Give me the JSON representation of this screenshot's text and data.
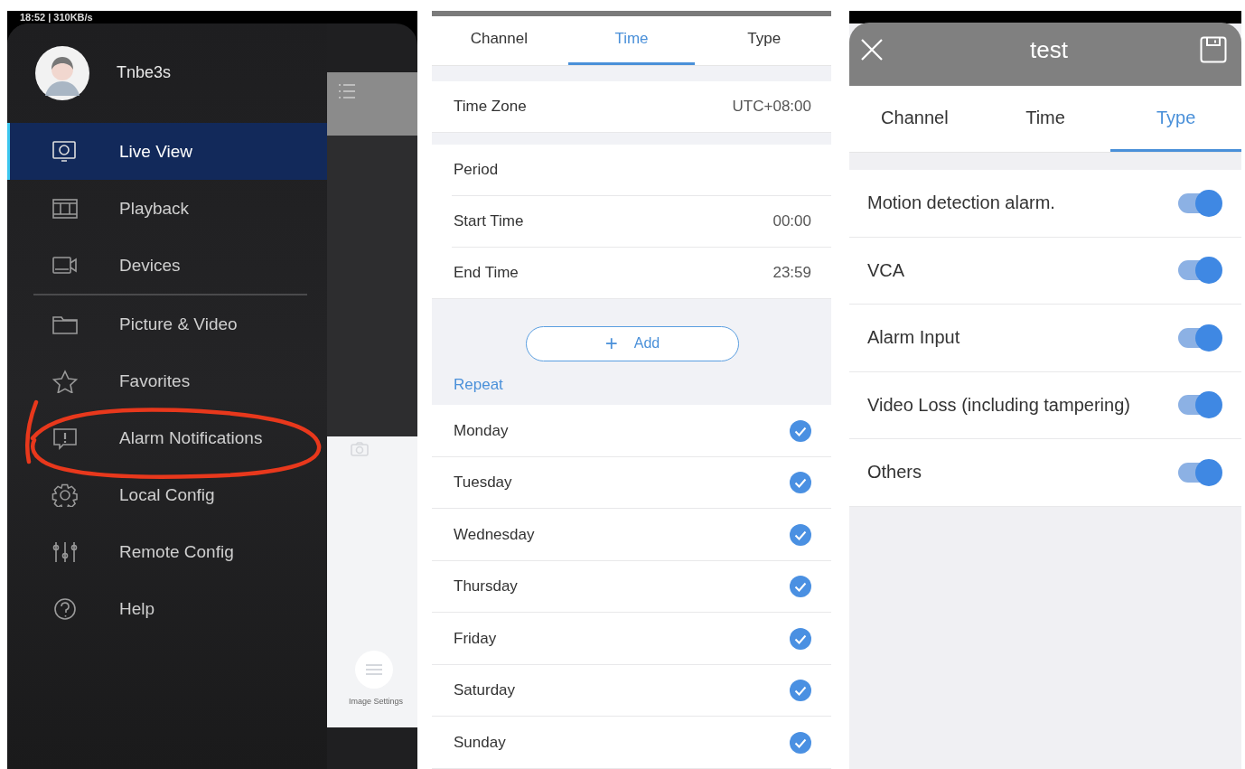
{
  "drawer": {
    "status_bar": {
      "text": "18:52 | 310KB/s"
    },
    "user": {
      "name": "Tnbe3s"
    },
    "groups": [
      {
        "items": [
          {
            "label": "Live View",
            "selected": true,
            "circled": false
          },
          {
            "label": "Playback",
            "selected": false,
            "circled": false
          },
          {
            "label": "Devices",
            "selected": false,
            "circled": false
          }
        ]
      },
      {
        "items": [
          {
            "label": "Picture & Video",
            "selected": false,
            "circled": false
          },
          {
            "label": "Favorites",
            "selected": false,
            "circled": false
          },
          {
            "label": "Alarm Notifications",
            "selected": false,
            "circled": true
          },
          {
            "label": "Local Config",
            "selected": false,
            "circled": false
          },
          {
            "label": "Remote Config",
            "selected": false,
            "circled": false
          },
          {
            "label": "Help",
            "selected": false,
            "circled": false
          }
        ]
      }
    ],
    "background_screen": {
      "image_settings_label": "Image Settings"
    }
  },
  "schedule": {
    "tabs": [
      {
        "label": "Channel",
        "selected": false
      },
      {
        "label": "Time",
        "selected": true
      },
      {
        "label": "Type",
        "selected": false
      }
    ],
    "time_zone": {
      "label": "Time Zone",
      "value": "UTC+08:00"
    },
    "period_rows": [
      {
        "label": "Period"
      },
      {
        "label": "Start Time",
        "value": "00:00"
      },
      {
        "label": "End Time",
        "value": "23:59"
      }
    ],
    "add_button": {
      "icon": "+",
      "label": "Add"
    },
    "repeat_label": "Repeat",
    "days": [
      {
        "label": "Monday",
        "checked": true
      },
      {
        "label": "Tuesday",
        "checked": true
      },
      {
        "label": "Wednesday",
        "checked": true
      },
      {
        "label": "Thursday",
        "checked": true
      },
      {
        "label": "Friday",
        "checked": true
      },
      {
        "label": "Saturday",
        "checked": true
      },
      {
        "label": "Sunday",
        "checked": true
      }
    ]
  },
  "type_screen": {
    "title": "test",
    "tabs": [
      {
        "label": "Channel",
        "selected": false
      },
      {
        "label": "Time",
        "selected": false
      },
      {
        "label": "Type",
        "selected": true
      }
    ],
    "alarm_types": [
      {
        "label": "Motion detection alarm.",
        "on": true
      },
      {
        "label": "VCA",
        "on": true
      },
      {
        "label": "Alarm Input",
        "on": true
      },
      {
        "label": "Video Loss (including tampering)",
        "on": true
      },
      {
        "label": "Others",
        "on": true
      }
    ]
  }
}
